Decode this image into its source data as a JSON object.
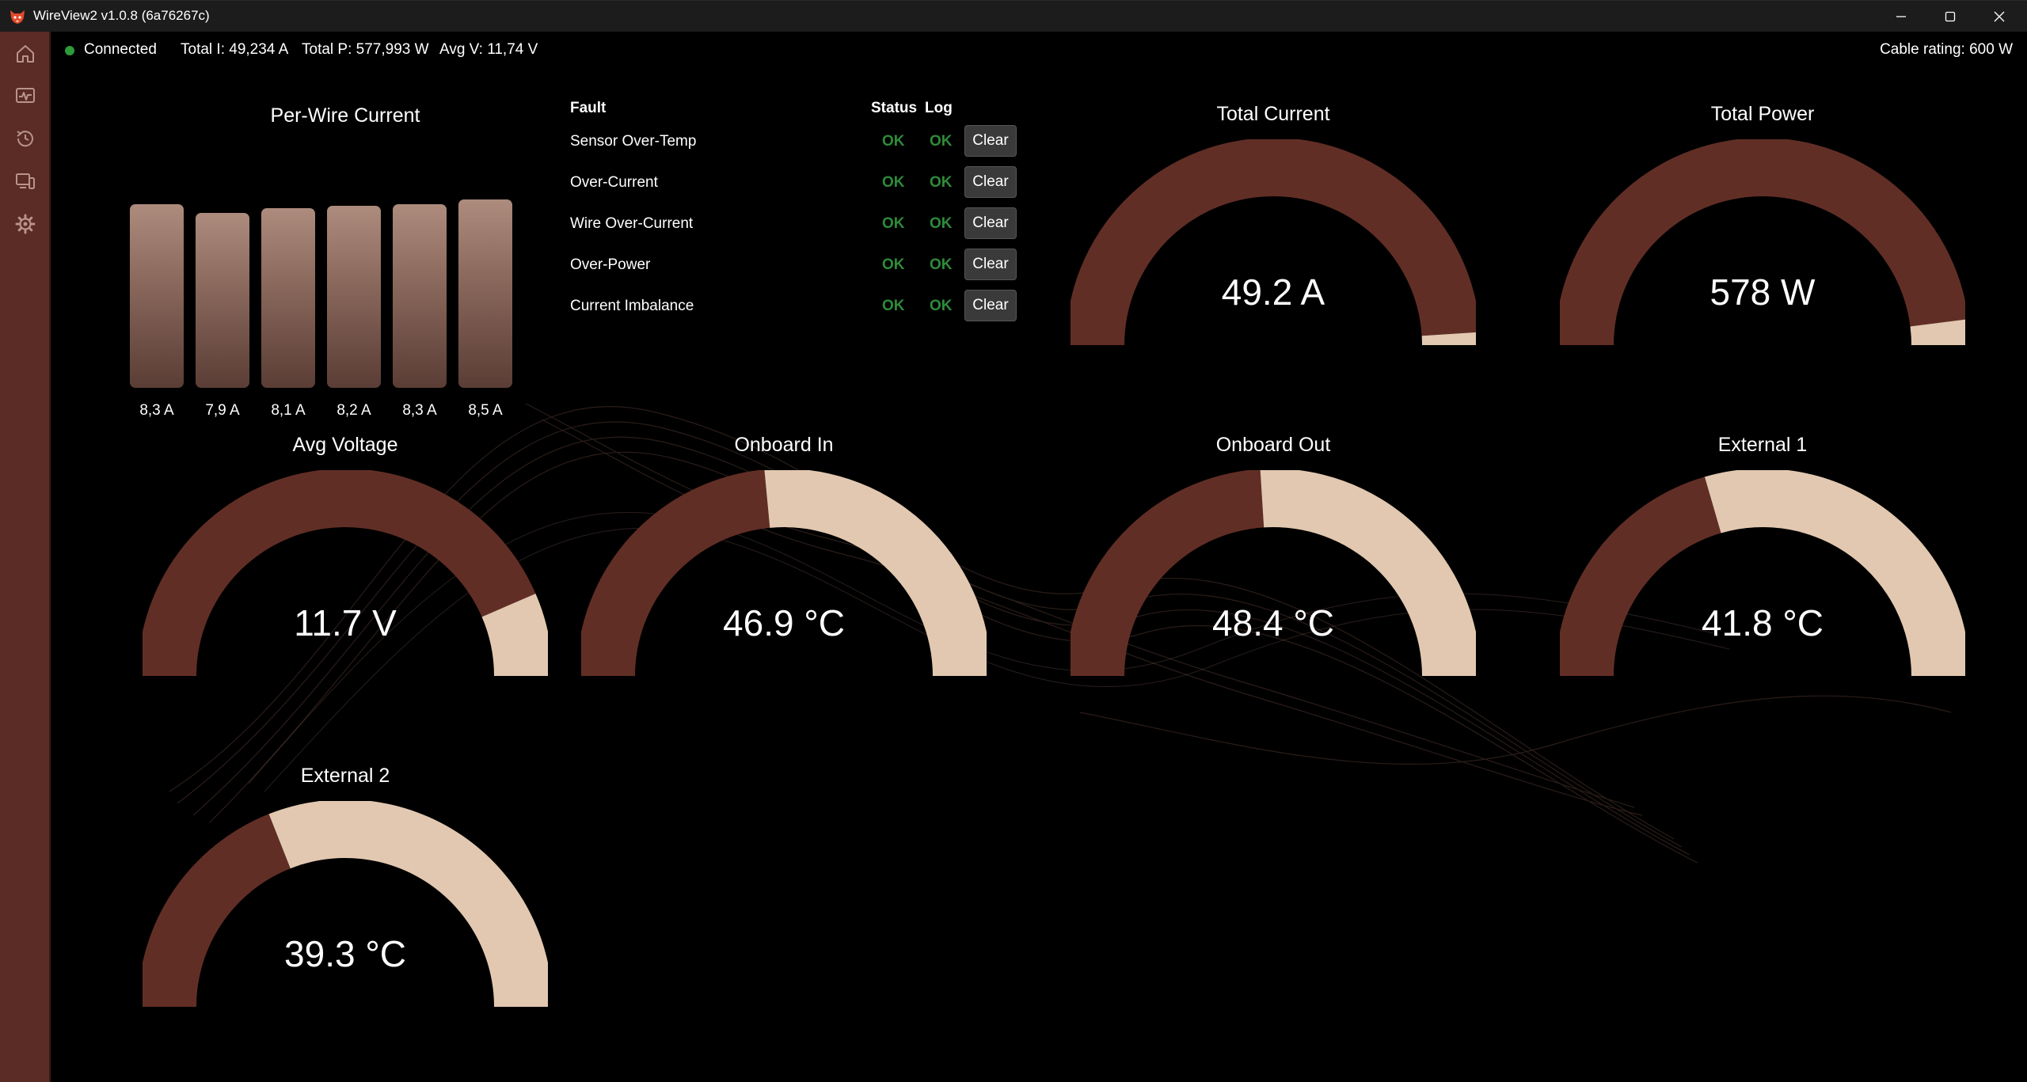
{
  "window": {
    "title": "WireView2 v1.0.8 (6a76267c)"
  },
  "status": {
    "connection": "Connected",
    "total_current": "Total I: 49,234 A",
    "total_power": "Total P: 577,993 W",
    "avg_voltage": "Avg V: 11,74 V",
    "cable_rating": "Cable rating: 600 W",
    "connected_color": "#2e9a3a"
  },
  "sidebar": {
    "items": [
      {
        "icon": "home-icon"
      },
      {
        "icon": "monitor-chart-icon"
      },
      {
        "icon": "history-icon"
      },
      {
        "icon": "devices-icon"
      },
      {
        "icon": "gear-icon"
      }
    ]
  },
  "per_wire": {
    "title": "Per-Wire Current",
    "wires": [
      {
        "label": "8,3 A",
        "value": 8.3
      },
      {
        "label": "7,9 A",
        "value": 7.9
      },
      {
        "label": "8,1 A",
        "value": 8.1
      },
      {
        "label": "8,2 A",
        "value": 8.2
      },
      {
        "label": "8,3 A",
        "value": 8.3
      },
      {
        "label": "8,5 A",
        "value": 8.5
      }
    ]
  },
  "faults": {
    "headers": {
      "fault": "Fault",
      "status": "Status",
      "log": "Log"
    },
    "clear_label": "Clear",
    "rows": [
      {
        "name": "Sensor Over-Temp",
        "status": "OK",
        "log": "OK"
      },
      {
        "name": "Over-Current",
        "status": "OK",
        "log": "OK"
      },
      {
        "name": "Wire Over-Current",
        "status": "OK",
        "log": "OK"
      },
      {
        "name": "Over-Power",
        "status": "OK",
        "log": "OK"
      },
      {
        "name": "Current Imbalance",
        "status": "OK",
        "log": "OK"
      }
    ]
  },
  "colors": {
    "gauge_track": "#612e26",
    "gauge_fill": "#e2c8b0",
    "ok_green": "#2e8b3a",
    "sidebar": "#5a2c25"
  },
  "gauges": {
    "total_current": {
      "title": "Total Current",
      "value": "49.2 A",
      "fraction": 0.02
    },
    "total_power": {
      "title": "Total Power",
      "value": "578 W",
      "fraction": 0.04
    },
    "avg_voltage": {
      "title": "Avg Voltage",
      "value": "11.7 V",
      "fraction": 0.13
    },
    "onboard_in": {
      "title": "Onboard In",
      "value": "46.9 °C",
      "fraction": 0.53
    },
    "onboard_out": {
      "title": "Onboard Out",
      "value": "48.4 °C",
      "fraction": 0.52
    },
    "external_1": {
      "title": "External 1",
      "value": "41.8 °C",
      "fraction": 0.59
    },
    "external_2": {
      "title": "External 2",
      "value": "39.3 °C",
      "fraction": 0.62
    }
  }
}
